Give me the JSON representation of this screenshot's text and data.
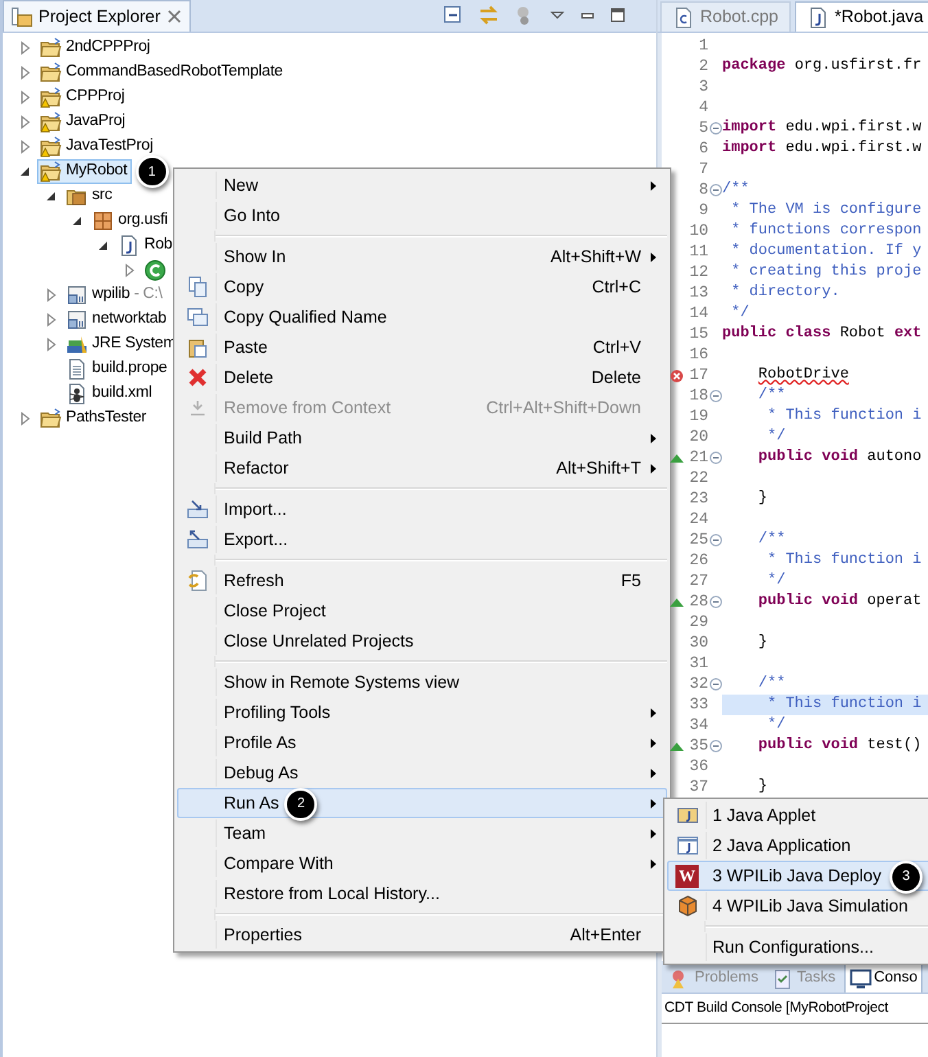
{
  "explorer": {
    "title": "Project Explorer",
    "tree": [
      {
        "label": "2ndCPPProj",
        "kind": "project",
        "warning": false,
        "expanded": false,
        "selected": false
      },
      {
        "label": "CommandBasedRobotTemplate",
        "kind": "project",
        "warning": false,
        "expanded": false,
        "selected": false
      },
      {
        "label": "CPPProj",
        "kind": "project",
        "warning": true,
        "expanded": false,
        "selected": false
      },
      {
        "label": "JavaProj",
        "kind": "project",
        "warning": true,
        "expanded": false,
        "selected": false
      },
      {
        "label": "JavaTestProj",
        "kind": "project",
        "warning": true,
        "expanded": false,
        "selected": false
      },
      {
        "label": "MyRobot",
        "kind": "project",
        "warning": true,
        "expanded": true,
        "selected": true,
        "badge": "1",
        "children": [
          {
            "label": "src",
            "kind": "folder",
            "expanded": true,
            "selected": false,
            "children": [
              {
                "label": "org.usfi",
                "kind": "package",
                "expanded": true,
                "selected": false,
                "children": [
                  {
                    "label": "Rob",
                    "kind": "file",
                    "expanded": true,
                    "selected": false,
                    "children": [
                      {
                        "kind": "class",
                        "expanded": false,
                        "selected": false
                      }
                    ]
                  }
                ]
              }
            ]
          },
          {
            "label": "wpilib",
            "detail": "- C:\\",
            "kind": "jar",
            "expanded": false,
            "selected": false
          },
          {
            "label": "networktab",
            "kind": "jar",
            "expanded": false,
            "selected": false
          },
          {
            "label": "JRE System",
            "kind": "library",
            "expanded": false,
            "selected": false
          },
          {
            "label": "build.prope",
            "kind": "text",
            "selected": false
          },
          {
            "label": "build.xml",
            "kind": "ant",
            "selected": false
          }
        ]
      },
      {
        "label": "PathsTester",
        "kind": "project",
        "warning": false,
        "expanded": false,
        "selected": false
      }
    ]
  },
  "editor": {
    "tabs": [
      {
        "label": "Robot.cpp",
        "kind": "c",
        "selected": false
      },
      {
        "label": "*Robot.java",
        "kind": "java",
        "selected": true
      }
    ],
    "lines": [
      {
        "n": "1",
        "fold": false,
        "current": false
      },
      {
        "n": "2",
        "fold": false,
        "current": false,
        "parts": [
          {
            "t": "package",
            "kind": "keyword"
          },
          {
            "t": " org.usfirst.fr",
            "kind": "plain"
          }
        ]
      },
      {
        "n": "3",
        "fold": false,
        "current": false
      },
      {
        "n": "4",
        "fold": false,
        "current": false
      },
      {
        "n": "5",
        "fold": true,
        "current": false,
        "parts": [
          {
            "t": "import",
            "kind": "keyword"
          },
          {
            "t": " edu.wpi.first.w",
            "kind": "plain"
          }
        ]
      },
      {
        "n": "6",
        "fold": false,
        "current": false,
        "parts": [
          {
            "t": "import",
            "kind": "keyword"
          },
          {
            "t": " edu.wpi.first.w",
            "kind": "plain"
          }
        ]
      },
      {
        "n": "7",
        "fold": false,
        "current": false
      },
      {
        "n": "8",
        "fold": true,
        "current": false,
        "parts": [
          {
            "t": "/**",
            "kind": "comment"
          }
        ]
      },
      {
        "n": "9",
        "fold": false,
        "current": false,
        "parts": [
          {
            "t": " * The VM is configure",
            "kind": "comment"
          }
        ]
      },
      {
        "n": "10",
        "fold": false,
        "current": false,
        "parts": [
          {
            "t": " * functions correspon",
            "kind": "comment"
          }
        ]
      },
      {
        "n": "11",
        "fold": false,
        "current": false,
        "parts": [
          {
            "t": " * documentation. If y",
            "kind": "comment"
          }
        ]
      },
      {
        "n": "12",
        "fold": false,
        "current": false,
        "parts": [
          {
            "t": " * creating this proje",
            "kind": "comment"
          }
        ]
      },
      {
        "n": "13",
        "fold": false,
        "current": false,
        "parts": [
          {
            "t": " * directory.",
            "kind": "comment"
          }
        ]
      },
      {
        "n": "14",
        "fold": false,
        "current": false,
        "parts": [
          {
            "t": " */",
            "kind": "comment"
          }
        ]
      },
      {
        "n": "15",
        "fold": false,
        "current": false,
        "parts": [
          {
            "t": "public class",
            "kind": "keyword"
          },
          {
            "t": " Robot ",
            "kind": "plain"
          },
          {
            "t": "ext",
            "kind": "keyword"
          }
        ]
      },
      {
        "n": "16",
        "fold": false,
        "current": false
      },
      {
        "n": "17",
        "fold": false,
        "current": false,
        "annotation": {
          "kind": "error"
        },
        "parts": [
          {
            "t": "    RobotDrive",
            "kind": "error"
          }
        ]
      },
      {
        "n": "18",
        "fold": true,
        "current": false,
        "parts": [
          {
            "t": "    /**",
            "kind": "comment"
          }
        ]
      },
      {
        "n": "19",
        "fold": false,
        "current": false,
        "parts": [
          {
            "t": "     * This function i",
            "kind": "comment"
          }
        ]
      },
      {
        "n": "20",
        "fold": false,
        "current": false,
        "parts": [
          {
            "t": "     */",
            "kind": "comment"
          }
        ]
      },
      {
        "n": "21",
        "fold": true,
        "current": false,
        "annotation": {
          "kind": "override"
        },
        "parts": [
          {
            "t": "    public void",
            "kind": "keyword"
          },
          {
            "t": " autono",
            "kind": "plain"
          }
        ]
      },
      {
        "n": "22",
        "fold": false,
        "current": false
      },
      {
        "n": "23",
        "fold": false,
        "current": false,
        "parts": [
          {
            "t": "    }",
            "kind": "plain"
          }
        ]
      },
      {
        "n": "24",
        "fold": false,
        "current": false
      },
      {
        "n": "25",
        "fold": true,
        "current": false,
        "parts": [
          {
            "t": "    /**",
            "kind": "comment"
          }
        ]
      },
      {
        "n": "26",
        "fold": false,
        "current": false,
        "parts": [
          {
            "t": "     * This function i",
            "kind": "comment"
          }
        ]
      },
      {
        "n": "27",
        "fold": false,
        "current": false,
        "parts": [
          {
            "t": "     */",
            "kind": "comment"
          }
        ]
      },
      {
        "n": "28",
        "fold": true,
        "current": false,
        "annotation": {
          "kind": "override"
        },
        "parts": [
          {
            "t": "    public void",
            "kind": "keyword"
          },
          {
            "t": " operat",
            "kind": "plain"
          }
        ]
      },
      {
        "n": "29",
        "fold": false,
        "current": false
      },
      {
        "n": "30",
        "fold": false,
        "current": false,
        "parts": [
          {
            "t": "    }",
            "kind": "plain"
          }
        ]
      },
      {
        "n": "31",
        "fold": false,
        "current": false
      },
      {
        "n": "32",
        "fold": true,
        "current": false,
        "parts": [
          {
            "t": "    /**",
            "kind": "comment"
          }
        ]
      },
      {
        "n": "33",
        "fold": false,
        "current": true,
        "parts": [
          {
            "t": "     * This function i",
            "kind": "comment"
          }
        ]
      },
      {
        "n": "34",
        "fold": false,
        "current": false,
        "parts": [
          {
            "t": "     */",
            "kind": "comment"
          }
        ]
      },
      {
        "n": "35",
        "fold": true,
        "current": false,
        "annotation": {
          "kind": "override"
        },
        "parts": [
          {
            "t": "    public void",
            "kind": "keyword"
          },
          {
            "t": " test()",
            "kind": "plain"
          }
        ]
      },
      {
        "n": "36",
        "fold": false,
        "current": false
      },
      {
        "n": "37",
        "fold": false,
        "current": false,
        "parts": [
          {
            "t": "    }",
            "kind": "plain"
          }
        ]
      }
    ]
  },
  "console": {
    "tabs": [
      {
        "label": "Problems",
        "kind": "problems",
        "selected": false
      },
      {
        "label": "Tasks",
        "kind": "tasks",
        "selected": false
      },
      {
        "label": "Conso",
        "kind": "console",
        "selected": true
      }
    ],
    "title": "CDT Build Console [MyRobotProject"
  },
  "context_menu": [
    {
      "kind": "item",
      "label": "New",
      "submenu": true,
      "disabled": false,
      "selected": false
    },
    {
      "kind": "item",
      "label": "Go Into",
      "submenu": false,
      "disabled": false,
      "selected": false
    },
    {
      "kind": "separator"
    },
    {
      "kind": "item",
      "label": "Show In",
      "shortcut": "Alt+Shift+W",
      "submenu": true,
      "disabled": false,
      "selected": false
    },
    {
      "kind": "item",
      "label": "Copy",
      "shortcut": "Ctrl+C",
      "submenu": false,
      "disabled": false,
      "selected": false
    },
    {
      "kind": "item",
      "label": "Copy Qualified Name",
      "submenu": false,
      "disabled": false,
      "selected": false
    },
    {
      "kind": "item",
      "label": "Paste",
      "shortcut": "Ctrl+V",
      "submenu": false,
      "disabled": false,
      "selected": false
    },
    {
      "kind": "item",
      "label": "Delete",
      "shortcut": "Delete",
      "submenu": false,
      "disabled": false,
      "selected": false
    },
    {
      "kind": "item",
      "label": "Remove from Context",
      "shortcut": "Ctrl+Alt+Shift+Down",
      "submenu": false,
      "disabled": true,
      "selected": false
    },
    {
      "kind": "item",
      "label": "Build Path",
      "submenu": true,
      "disabled": false,
      "selected": false
    },
    {
      "kind": "item",
      "label": "Refactor",
      "shortcut": "Alt+Shift+T",
      "submenu": true,
      "disabled": false,
      "selected": false
    },
    {
      "kind": "separator"
    },
    {
      "kind": "item",
      "label": "Import...",
      "submenu": false,
      "disabled": false,
      "selected": false
    },
    {
      "kind": "item",
      "label": "Export...",
      "submenu": false,
      "disabled": false,
      "selected": false
    },
    {
      "kind": "separator"
    },
    {
      "kind": "item",
      "label": "Refresh",
      "shortcut": "F5",
      "submenu": false,
      "disabled": false,
      "selected": false
    },
    {
      "kind": "item",
      "label": "Close Project",
      "submenu": false,
      "disabled": false,
      "selected": false
    },
    {
      "kind": "item",
      "label": "Close Unrelated Projects",
      "submenu": false,
      "disabled": false,
      "selected": false
    },
    {
      "kind": "separator"
    },
    {
      "kind": "item",
      "label": "Show in Remote Systems view",
      "submenu": false,
      "disabled": false,
      "selected": false
    },
    {
      "kind": "item",
      "label": "Profiling Tools",
      "submenu": true,
      "disabled": false,
      "selected": false
    },
    {
      "kind": "item",
      "label": "Profile As",
      "submenu": true,
      "disabled": false,
      "selected": false
    },
    {
      "kind": "item",
      "label": "Debug As",
      "submenu": true,
      "disabled": false,
      "selected": false
    },
    {
      "kind": "item",
      "label": "Run As",
      "submenu": true,
      "disabled": false,
      "selected": true,
      "badge": "2"
    },
    {
      "kind": "item",
      "label": "Team",
      "submenu": true,
      "disabled": false,
      "selected": false
    },
    {
      "kind": "item",
      "label": "Compare With",
      "submenu": true,
      "disabled": false,
      "selected": false
    },
    {
      "kind": "item",
      "label": "Restore from Local History...",
      "submenu": false,
      "disabled": false,
      "selected": false
    },
    {
      "kind": "separator"
    },
    {
      "kind": "item",
      "label": "Properties",
      "shortcut": "Alt+Enter",
      "submenu": false,
      "disabled": false,
      "selected": false
    }
  ],
  "run_as_menu": [
    {
      "kind": "item",
      "label": "1 Java Applet",
      "selected": false
    },
    {
      "kind": "item",
      "label": "2 Java Application",
      "selected": false
    },
    {
      "kind": "item",
      "label": "3 WPILib Java Deploy",
      "logo": "W",
      "selected": true,
      "badge": "3"
    },
    {
      "kind": "item",
      "label": "4 WPILib Java Simulation",
      "selected": false
    },
    {
      "kind": "separator"
    },
    {
      "kind": "item",
      "label": "Run Configurations...",
      "selected": false
    }
  ]
}
